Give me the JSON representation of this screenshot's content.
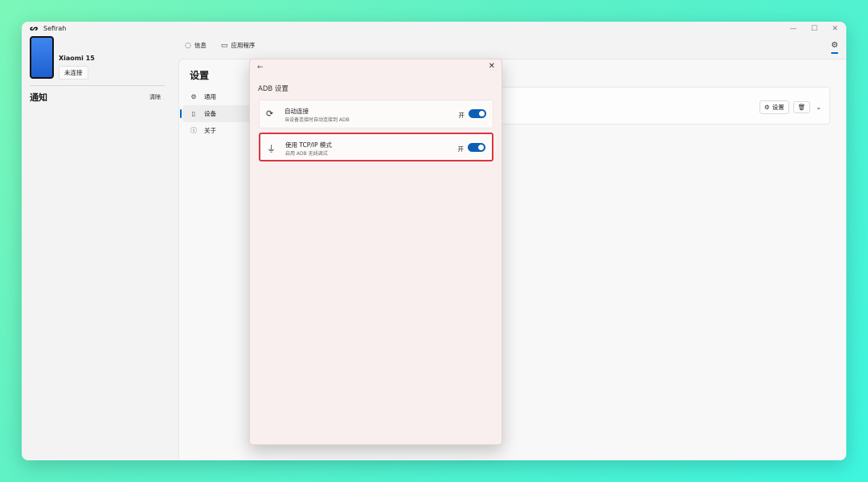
{
  "app": {
    "logo": "ᔕ",
    "title": "Sefirah",
    "window_controls": [
      "—",
      "☐",
      "✕"
    ]
  },
  "device": {
    "name": "Xiaomi 15",
    "status": "未连接"
  },
  "notifications": {
    "title": "通知",
    "clear_label": "清除"
  },
  "topnav": [
    {
      "icon": "message-icon",
      "glyph": "◌",
      "label": "信息"
    },
    {
      "icon": "apps-icon",
      "glyph": "▭",
      "label": "应用程序"
    }
  ],
  "settings": {
    "title": "设置",
    "nav": [
      {
        "icon": "gear-icon",
        "glyph": "⚙",
        "label": "通用"
      },
      {
        "icon": "phone-icon",
        "glyph": "▯",
        "label": "设备",
        "active": true
      },
      {
        "icon": "info-icon",
        "glyph": "ⓘ",
        "label": "关于"
      }
    ],
    "device_row": {
      "settings_label": "设置",
      "settings_glyph": "⚙",
      "delete_glyph": "🗑",
      "expand_glyph": "⌄"
    }
  },
  "dialog": {
    "back_glyph": "←",
    "close_glyph": "✕",
    "title": "ADB 设置",
    "options": [
      {
        "icon": "sync-icon",
        "glyph": "⟳",
        "title": "自动连接",
        "description": "当设备连接时自动连接到 ADB",
        "state": "开",
        "enabled": true
      },
      {
        "icon": "usb-icon",
        "glyph": "⏚",
        "title": "使用 TCP/IP 模式",
        "description": "启用 ADB 无线调试",
        "state": "开",
        "enabled": true
      }
    ]
  },
  "colors": {
    "accent": "#0067c0",
    "toggle_on": "#0a5fb5",
    "highlight": "#d9363e"
  }
}
